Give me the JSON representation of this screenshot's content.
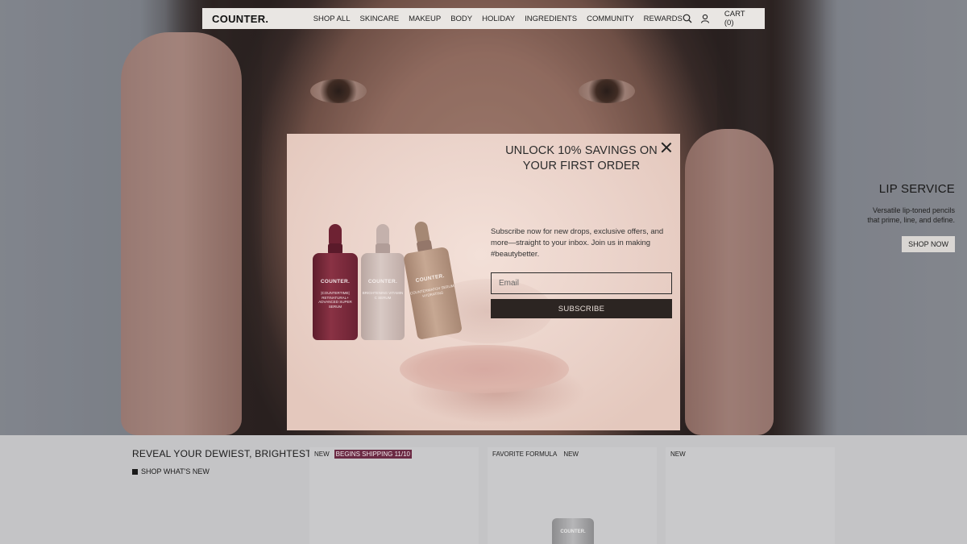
{
  "nav": {
    "logo": "COUNTER.",
    "links": [
      "SHOP ALL",
      "SKINCARE",
      "MAKEUP",
      "BODY",
      "HOLIDAY",
      "INGREDIENTS",
      "COMMUNITY",
      "REWARDS"
    ],
    "search_icon": "search-icon",
    "account_icon": "user-icon",
    "cart_label": "CART (0)"
  },
  "promo": {
    "title": "LIP SERVICE",
    "desc_line1": "Versatile lip-toned pencils",
    "desc_line2": "that prime, line, and define.",
    "button": "SHOP NOW"
  },
  "modal": {
    "title": "UNLOCK 10% SAVINGS ON YOUR FIRST ORDER",
    "description": "Subscribe now for new drops, exclusive offers, and more—straight to your inbox. Join us in making #beautybetter.",
    "email_placeholder": "Email",
    "subscribe_label": "SUBSCRIBE",
    "close_icon": "close-icon",
    "bottles": [
      {
        "brand": "COUNTER.",
        "text": "|COUNTERTIME| RETINATURAL+ ADVANCED SUPER SERUM",
        "color": "#7a2a3a"
      },
      {
        "brand": "COUNTER.",
        "text": "BRIGHTENING VITAMIN C SERUM",
        "color": "#c9b8b3"
      },
      {
        "brand": "COUNTER.",
        "text": "COUNTERMATCH SERUM HYDRATING",
        "color": "#b3917a"
      }
    ]
  },
  "lower": {
    "title": "REVEAL YOUR DEWIEST, BRIGHTEST SKIN",
    "link": "SHOP WHAT'S NEW",
    "cards": [
      {
        "tags": [
          "NEW",
          "BEGINS SHIPPING 11/10"
        ]
      },
      {
        "tags": [
          "FAVORITE FORMULA",
          "NEW"
        ],
        "product_label": "COUNTER."
      },
      {
        "tags": [
          "NEW"
        ]
      }
    ]
  },
  "colors": {
    "accent_tag": "#6b2a44",
    "subscribe_bg": "#2c2522",
    "modal_bg": "#ecd9d3"
  }
}
